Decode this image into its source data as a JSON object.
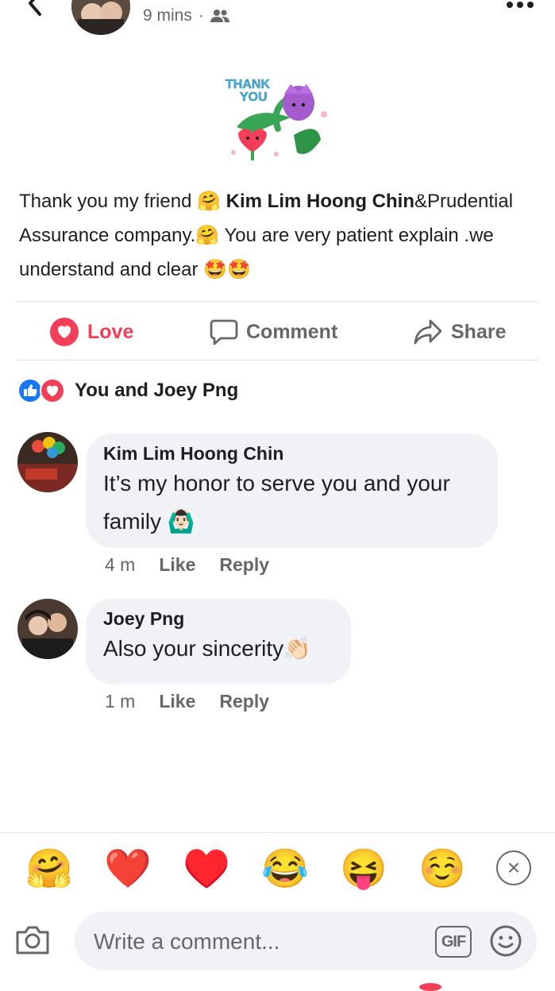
{
  "header": {
    "time": "9 mins",
    "separator": "·",
    "audience_icon": "friends-icon",
    "back_icon": "chevron-left-icon",
    "more_icon": "more-dots-icon"
  },
  "sticker": {
    "text_line1": "THANK",
    "text_line2": "YOU"
  },
  "post": {
    "p1": "Thank you my friend",
    "e1": "🤗",
    "mention": "Kim Lim Hoong Chin",
    "p2": "&Prudential Assurance company.",
    "e2": "🤗",
    "p3": " You are very patient explain .we understand and clear ",
    "e3": "🤩🤩"
  },
  "actions": {
    "love": "Love",
    "comment": "Comment",
    "share": "Share"
  },
  "reactions": {
    "label": "You and Joey Png"
  },
  "comments": [
    {
      "name": "Kim Lim Hoong Chin",
      "line1": "It’s my honor to serve you and your",
      "line2": "family",
      "emoji": "🙆🏻‍♂️",
      "time": "4 m",
      "like": "Like",
      "reply": "Reply"
    },
    {
      "name": "Joey Png",
      "line1": "Also your sincerity",
      "emoji": "👏🏻",
      "time": "1 m",
      "like": "Like",
      "reply": "Reply"
    }
  ],
  "emoji_strip": [
    "🤗",
    "❤️",
    "♥️",
    "😂",
    "😝",
    "☺️"
  ],
  "composer": {
    "placeholder": "Write a comment...",
    "gif": "GIF"
  },
  "colors": {
    "love": "#f33e58",
    "like_blue": "#1877f2",
    "muted": "#65676b",
    "bubble": "#f0f2f5"
  }
}
